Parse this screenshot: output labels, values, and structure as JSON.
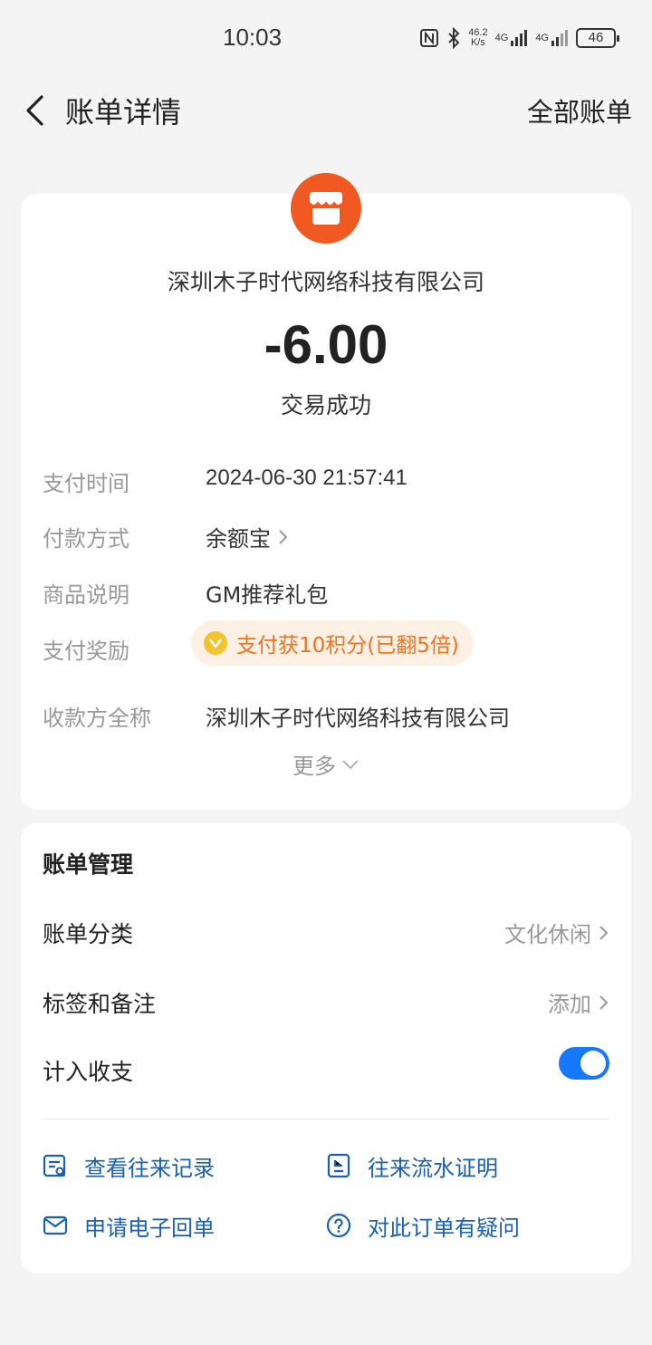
{
  "status_bar": {
    "time": "10:03",
    "net_speed_value": "46.2",
    "net_speed_unit": "K/s",
    "signal1_label": "4G",
    "signal2_label": "4G",
    "battery": "46"
  },
  "nav": {
    "title": "账单详情",
    "right_link": "全部账单"
  },
  "summary": {
    "merchant_name": "深圳木子时代网络科技有限公司",
    "amount": "-6.00",
    "status": "交易成功",
    "logo_color": "#f05a22"
  },
  "details": {
    "pay_time_label": "支付时间",
    "pay_time_value": "2024-06-30 21:57:41",
    "pay_method_label": "付款方式",
    "pay_method_value": "余额宝",
    "product_label": "商品说明",
    "product_value": "GM推荐礼包",
    "reward_label": "支付奖励",
    "reward_value": "支付获10积分(已翻5倍)",
    "payee_label": "收款方全称",
    "payee_value": "深圳木子时代网络科技有限公司",
    "more_label": "更多"
  },
  "management": {
    "title": "账单管理",
    "category_label": "账单分类",
    "category_value": "文化休闲",
    "tags_label": "标签和备注",
    "tags_value": "添加",
    "include_label": "计入收支",
    "include_enabled": true,
    "links": {
      "history": "查看往来记录",
      "statement": "往来流水证明",
      "receipt": "申请电子回单",
      "question": "对此订单有疑问"
    }
  },
  "colors": {
    "accent_blue": "#1677ff",
    "link_blue": "#1a5fb4",
    "reward_orange": "#f0731f"
  }
}
